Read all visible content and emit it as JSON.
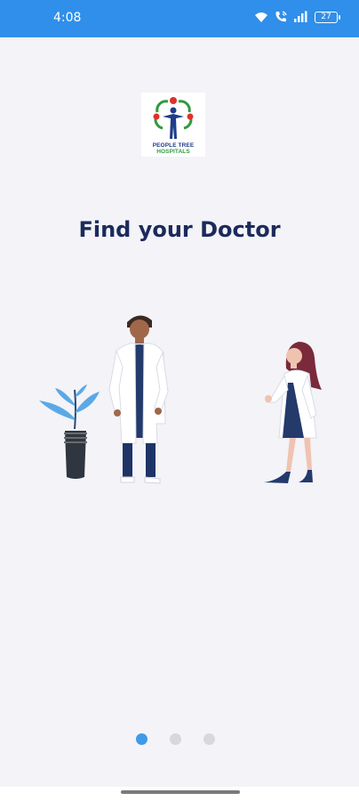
{
  "status_bar": {
    "time": "4:08",
    "battery": "27",
    "icons": [
      "wifi-icon",
      "wifi-calling-icon",
      "signal-icon",
      "battery-icon"
    ],
    "background": "#2f8fea"
  },
  "logo": {
    "line1": "PEOPLE TREE",
    "line2": "HOSPITALS",
    "colors": {
      "blue": "#1f3c8a",
      "green": "#2e9a3e",
      "red": "#e0312b"
    }
  },
  "onboarding": {
    "title": "Find your Doctor",
    "page_count": 3,
    "active_page": 1,
    "colors": {
      "active_dot": "#3d9be9",
      "inactive_dot": "#d8d8dc",
      "title": "#1c2a5c",
      "background": "#f3f3f8"
    }
  }
}
